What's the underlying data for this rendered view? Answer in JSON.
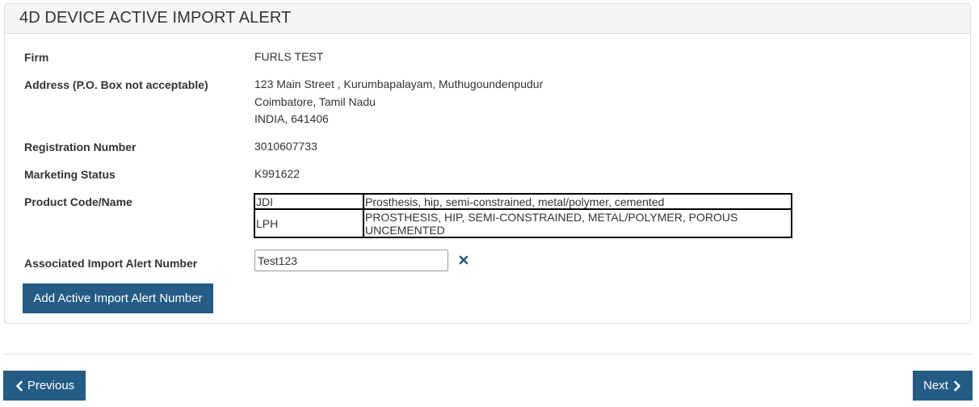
{
  "panel": {
    "title": "4D DEVICE ACTIVE IMPORT ALERT"
  },
  "fields": {
    "firm": {
      "label": "Firm",
      "value": "FURLS TEST"
    },
    "address": {
      "label": "Address (P.O. Box not acceptable)",
      "lines": [
        "123 Main Street , Kurumbapalayam, Muthugoundenpudur",
        "Coimbatore, Tamil Nadu",
        "INDIA, 641406"
      ]
    },
    "registration": {
      "label": "Registration Number",
      "value": "3010607733"
    },
    "marketing": {
      "label": "Marketing Status",
      "value": "K991622"
    },
    "product": {
      "label": "Product Code/Name",
      "rows": [
        {
          "code": "JDI",
          "name": "Prosthesis, hip, semi-constrained, metal/polymer, cemented"
        },
        {
          "code": "LPH",
          "name": "PROSTHESIS, HIP, SEMI-CONSTRAINED, METAL/POLYMER, POROUS UNCEMENTED"
        }
      ]
    },
    "alert_number": {
      "label": "Associated Import Alert Number",
      "value": "Test123"
    }
  },
  "icons": {
    "remove": "close-icon",
    "previous": "chevron-left-icon",
    "next": "chevron-right-icon"
  },
  "buttons": {
    "add": "Add Active Import Alert Number",
    "previous": "Previous",
    "next": "Next"
  },
  "colors": {
    "primary_button": "#245c85",
    "remove_icon": "#245c85",
    "heading_bg": "#f5f5f5"
  }
}
